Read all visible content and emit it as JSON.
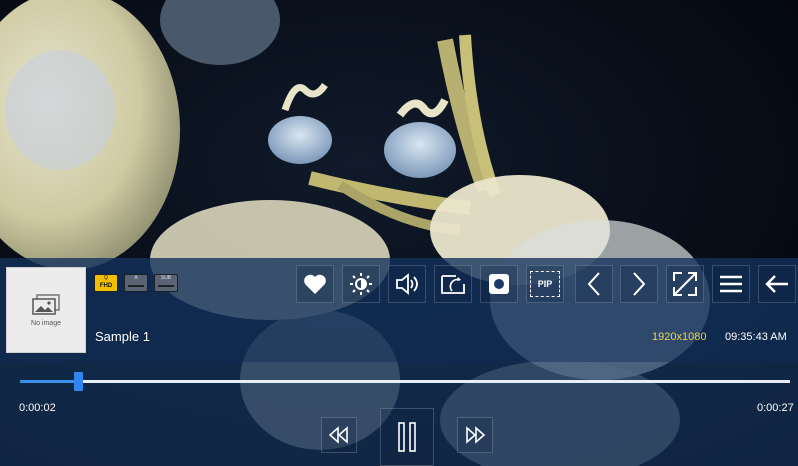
{
  "media": {
    "title": "Sample 1",
    "resolution": "1920x1080",
    "clock": "09:35:43 AM",
    "thumbnail_text": "No image"
  },
  "badges": [
    {
      "top": "Q",
      "label": "FHD"
    },
    {
      "top": "A",
      "label": ""
    },
    {
      "top": "SUB",
      "label": ""
    }
  ],
  "toolbar": {
    "pip_label": "PIP",
    "icons": [
      "heart-icon",
      "brightness-icon",
      "volume-icon",
      "rotate-icon",
      "record-icon",
      "pip-icon",
      "previous-icon",
      "next-icon",
      "fullscreen-icon",
      "menu-icon",
      "back-icon"
    ]
  },
  "playback": {
    "current_time": "0:00:02",
    "duration": "0:00:27",
    "progress_fraction": 0.075,
    "state": "playing"
  },
  "colors": {
    "accent": "#2f86f0",
    "resolution_text": "#f2d14a",
    "panel": "#183a68"
  }
}
